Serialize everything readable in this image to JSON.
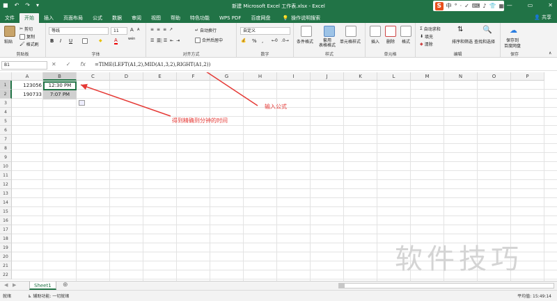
{
  "titlebar": {
    "title": "新建 Microsoft Excel 工作表.xlsx - Excel",
    "ime_logo": "S",
    "ime_items": [
      "中",
      "°",
      "·",
      "✓",
      "⌨",
      "♪",
      "👕",
      "▦"
    ],
    "minimize": "—",
    "restore": "▭",
    "close": "✕"
  },
  "tabs": [
    "文件",
    "开始",
    "插入",
    "页面布局",
    "公式",
    "数据",
    "审阅",
    "视图",
    "帮助",
    "特色功能",
    "WPS PDF",
    "百度网盘"
  ],
  "active_tab": "开始",
  "tell_me": "操作说明搜索",
  "share": "共享",
  "ribbon": {
    "clipboard": {
      "paste": "粘贴",
      "cut": "剪切",
      "copy": "复制",
      "format_painter": "格式刷",
      "label": "剪贴板"
    },
    "font": {
      "name": "等线",
      "size": "11",
      "bold": "B",
      "italic": "I",
      "underline": "U",
      "font_color": "A",
      "wen": "wén",
      "grow": "A",
      "shrink": "A",
      "label": "字体"
    },
    "alignment": {
      "wrap": "自动换行",
      "merge": "合并后居中",
      "label": "对齐方式"
    },
    "number": {
      "format": "自定义",
      "percent": "%",
      "comma": ",",
      "label": "数字"
    },
    "styles": {
      "conditional": "条件格式",
      "table": "套用\n表格格式",
      "cell_styles": "单元格样式",
      "label": "样式"
    },
    "cells": {
      "insert": "插入",
      "delete": "删除",
      "format": "格式",
      "label": "单元格"
    },
    "editing": {
      "autosum": "自动求和",
      "fill": "填充",
      "clear": "清除",
      "sort": "排序和筛选",
      "find": "查找和选择",
      "label": "编辑"
    },
    "save": {
      "label1": "保存到",
      "label2": "百度网盘",
      "group": "保存"
    }
  },
  "formula_bar": {
    "name_box": "B1",
    "cancel": "✕",
    "enter": "✓",
    "fx": "fx",
    "formula": "=TIME(LEFT(A1,2),MID(A1,3,2),RIGHT(A1,2))"
  },
  "columns": [
    "A",
    "B",
    "C",
    "D",
    "E",
    "F",
    "G",
    "H",
    "I",
    "J",
    "K",
    "L",
    "M",
    "N",
    "O",
    "P"
  ],
  "rows": [
    "1",
    "2",
    "3",
    "4",
    "5",
    "6",
    "7",
    "8",
    "9",
    "10",
    "11",
    "12",
    "13",
    "14",
    "15",
    "16",
    "17",
    "18",
    "19",
    "20",
    "21",
    "22"
  ],
  "cells": {
    "A1": "123056",
    "A2": "190733",
    "B1": "12:30 PM",
    "B2": "7:07 PM"
  },
  "sheet_tab": "Sheet1",
  "status": {
    "ready": "就绪",
    "accessibility": "辅助功能: 一切就绪",
    "average": "平均值: 15:49:14"
  },
  "annotations": {
    "formula_note": "输入公式",
    "result_note": "得到精确到分钟的时间"
  },
  "watermark": "软件技巧",
  "colors": {
    "accent": "#217346",
    "annotation": "#e53935"
  }
}
